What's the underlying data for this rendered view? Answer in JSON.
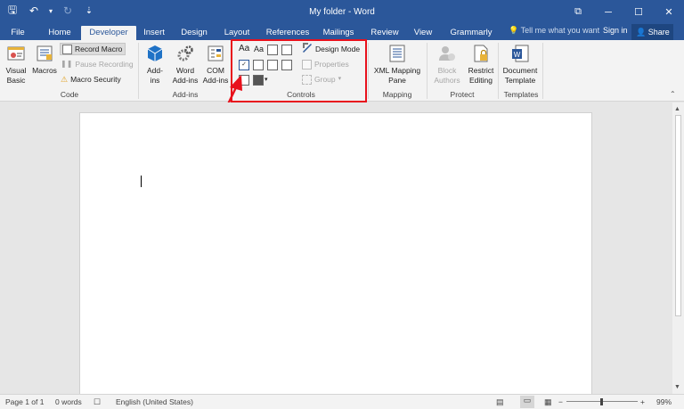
{
  "window": {
    "title": "My folder - Word",
    "controls": {
      "ribbon_display": "⧉",
      "minimize": "─",
      "maximize": "☐",
      "close": "✕"
    }
  },
  "qat": {
    "save": "🖫",
    "undo": "↶",
    "undo_dropdown": "▾",
    "redo": "↻",
    "customize": "⇣"
  },
  "tabs": [
    {
      "label": "File"
    },
    {
      "label": "Home"
    },
    {
      "label": "Developer"
    },
    {
      "label": "Insert"
    },
    {
      "label": "Design"
    },
    {
      "label": "Layout"
    },
    {
      "label": "References"
    },
    {
      "label": "Mailings"
    },
    {
      "label": "Review"
    },
    {
      "label": "View"
    },
    {
      "label": "Grammarly"
    }
  ],
  "tell_me": "Tell me what you want",
  "sign_in": "Sign in",
  "share": "Share",
  "ribbon": {
    "code": {
      "label": "Code",
      "visual_basic": "Visual\nBasic",
      "macros": "Macros",
      "record_macro": "Record Macro",
      "pause_recording": "Pause Recording",
      "macro_security": "Macro Security"
    },
    "addins": {
      "label": "Add-ins",
      "addins": "Add-\nins",
      "word_addins": "Word\nAdd-ins",
      "com_addins": "COM\nAdd-ins"
    },
    "controls": {
      "label": "Controls",
      "design_mode": "Design Mode",
      "properties": "Properties",
      "group": "Group",
      "rich_text": "Aa",
      "plain_text": "Aa"
    },
    "mapping": {
      "label": "Mapping",
      "xml_pane": "XML Mapping\nPane"
    },
    "protect": {
      "label": "Protect",
      "block_authors": "Block\nAuthors",
      "restrict_editing": "Restrict\nEditing"
    },
    "templates": {
      "label": "Templates",
      "document_template": "Document\nTemplate"
    }
  },
  "status": {
    "page": "Page 1 of 1",
    "words": "0 words",
    "language": "English (United States)",
    "zoom": "99%",
    "zoom_minus": "−",
    "zoom_plus": "+"
  },
  "colors": {
    "brand": "#2b579a",
    "highlight": "#e8111c"
  }
}
